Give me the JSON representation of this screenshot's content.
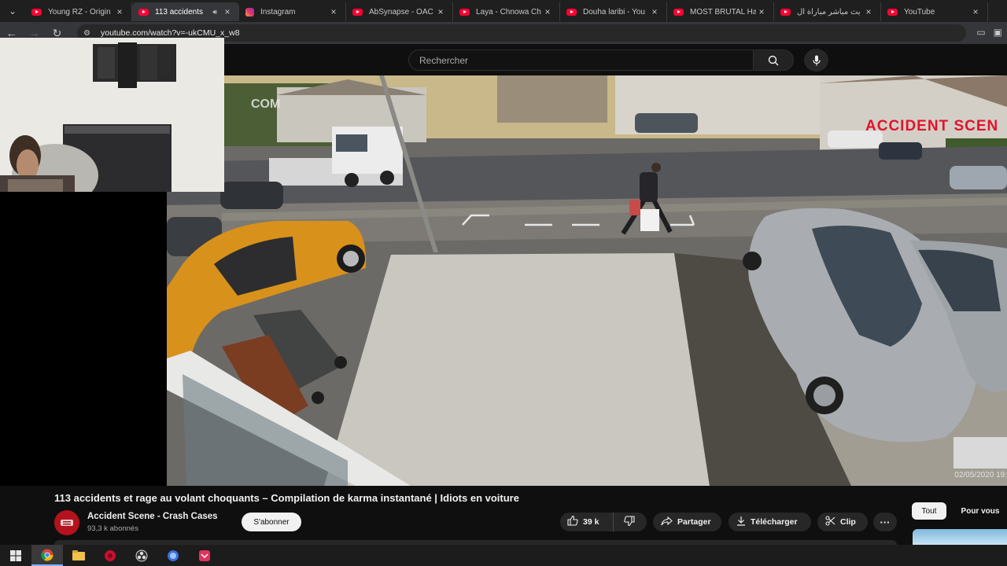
{
  "browser": {
    "tabs": [
      {
        "title": "Young RZ - Origin",
        "icon": "youtube-favicon",
        "active": false
      },
      {
        "title": "113 accidents",
        "icon": "youtube-favicon",
        "active": true,
        "audio": true
      },
      {
        "title": "Instagram",
        "icon": "instagram-favicon",
        "active": false
      },
      {
        "title": "AbSynapse - OAC",
        "icon": "youtube-favicon",
        "active": false
      },
      {
        "title": "Laya - Chnowa Ch",
        "icon": "youtube-favicon",
        "active": false
      },
      {
        "title": "Douha laribi - You",
        "icon": "youtube-favicon",
        "active": false
      },
      {
        "title": "MOST BRUTAL Ha",
        "icon": "youtube-favicon",
        "active": false
      },
      {
        "title": "بث مباشر مباراة ال",
        "icon": "youtube-favicon",
        "active": false
      },
      {
        "title": "YouTube",
        "icon": "youtube-favicon",
        "active": false
      }
    ],
    "url": "youtube.com/watch?v=-ukCMU_x_w8"
  },
  "youtube": {
    "search_placeholder": "Rechercher"
  },
  "video": {
    "overlay_left": "COM",
    "overlay_right": "ACCIDENT SCEN",
    "timestamp": "02/05/2020 19:",
    "title": "113 accidents et rage au volant choquants – Compilation de karma instantané | Idiots en voiture"
  },
  "channel": {
    "name": "Accident Scene - Crash Cases",
    "subscribers": "93,3 k abonnés",
    "subscribe_label": "S'abonner"
  },
  "actions": {
    "likes": "39 k",
    "share": "Partager",
    "download": "Télécharger",
    "clip": "Clip",
    "more": "···"
  },
  "filters": {
    "all": "Tout",
    "for_you": "Pour vous"
  },
  "colors": {
    "youtube_red": "#ff0033",
    "overlay_red": "#e0142b",
    "background": "#0f0f0f"
  }
}
